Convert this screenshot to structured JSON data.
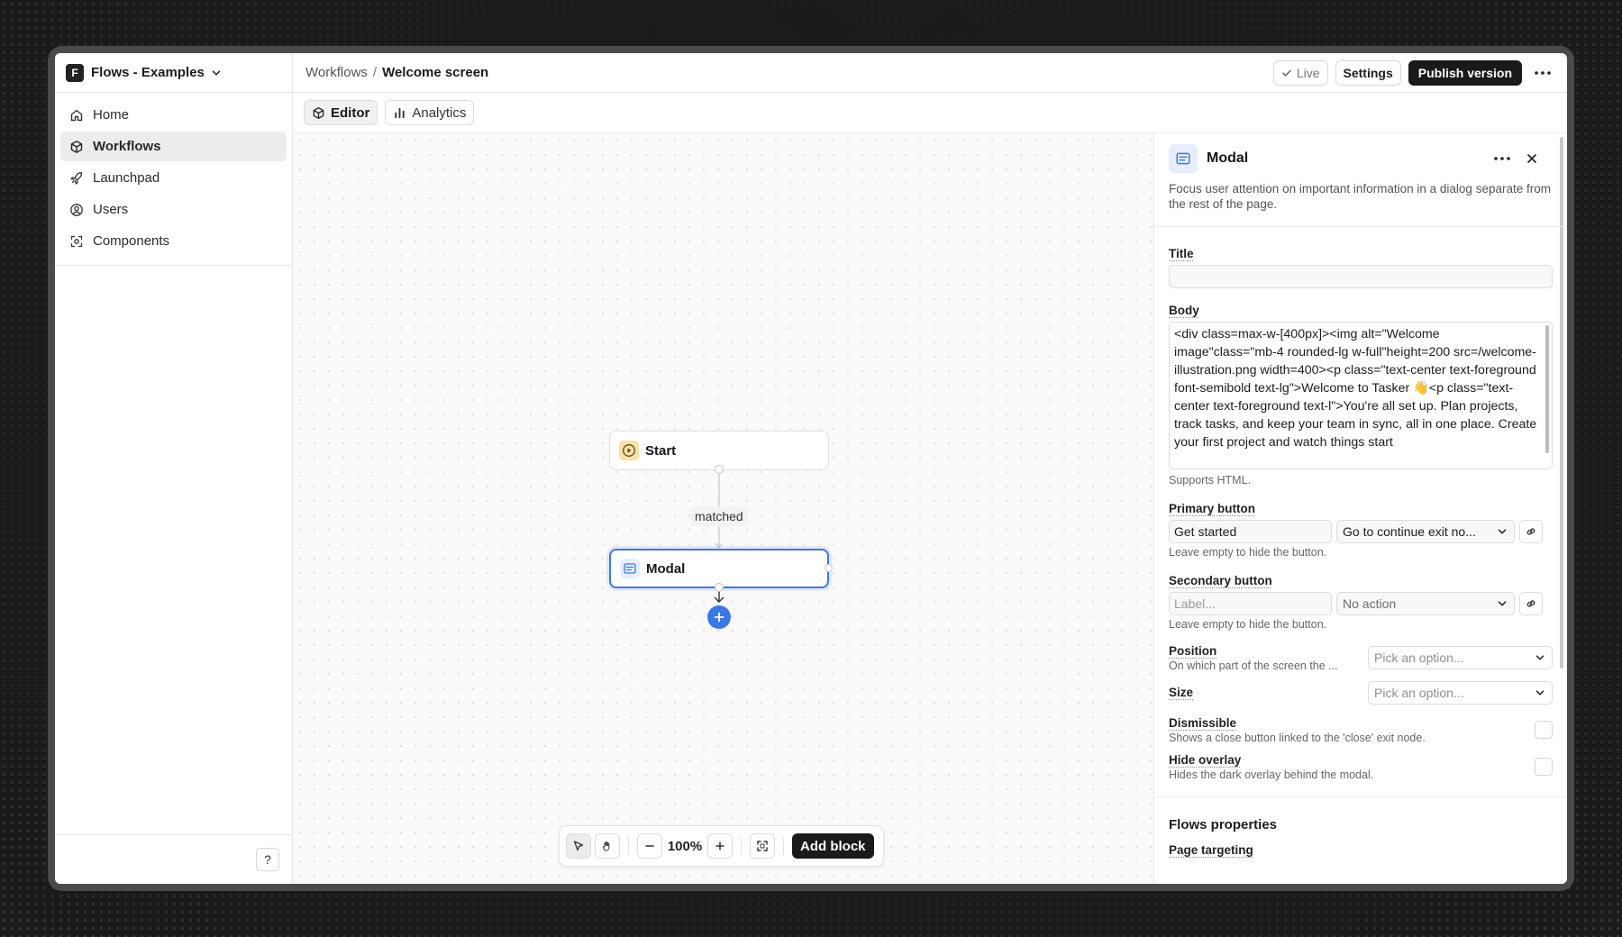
{
  "workspace": {
    "logo": "F",
    "name": "Flows - Examples"
  },
  "nav": [
    {
      "label": "Home",
      "icon": "home-icon",
      "active": false
    },
    {
      "label": "Workflows",
      "icon": "workflow-icon",
      "active": true
    },
    {
      "label": "Launchpad",
      "icon": "rocket-icon",
      "active": false
    },
    {
      "label": "Users",
      "icon": "user-circle-icon",
      "active": false
    },
    {
      "label": "Components",
      "icon": "components-icon",
      "active": false
    }
  ],
  "help_label": "?",
  "breadcrumb": {
    "parent": "Workflows",
    "separator": "/",
    "current": "Welcome screen"
  },
  "top_actions": {
    "live": "Live",
    "settings": "Settings",
    "publish": "Publish version"
  },
  "tabs": [
    {
      "label": "Editor",
      "active": true
    },
    {
      "label": "Analytics",
      "active": false
    }
  ],
  "canvas": {
    "nodes": [
      {
        "label": "Start",
        "icon": "play-icon"
      },
      {
        "label": "Modal",
        "icon": "modal-icon",
        "selected": true
      }
    ],
    "edge_label": "matched",
    "zoom": "100%",
    "add_block": "Add block"
  },
  "panel": {
    "title": "Modal",
    "description": "Focus user attention on important information in a dialog separate from the rest of the page.",
    "title_field": {
      "label": "Title",
      "value": ""
    },
    "body_field": {
      "label": "Body",
      "value": "<div class=max-w-[400px]><img alt=\"Welcome image\"class=\"mb-4 rounded-lg w-full\"height=200 src=/welcome-illustration.png width=400><p class=\"text-center text-foreground font-semibold text-lg\">Welcome to Tasker 👋<p class=\"text-center text-foreground text-l\">You're all set up. Plan projects, track tasks, and keep your team in sync, all in one place. Create your first project and watch things start",
      "help": "Supports HTML."
    },
    "primary_button": {
      "label": "Primary button",
      "value": "Get started",
      "action": "Go to continue exit no...",
      "help": "Leave empty to hide the button."
    },
    "secondary_button": {
      "label": "Secondary button",
      "placeholder": "Label...",
      "action": "No action",
      "help": "Leave empty to hide the button."
    },
    "position": {
      "label": "Position",
      "help": "On which part of the screen the ...",
      "placeholder": "Pick an option..."
    },
    "size": {
      "label": "Size",
      "placeholder": "Pick an option..."
    },
    "dismissible": {
      "label": "Dismissible",
      "help": "Shows a close button linked to the 'close' exit node.",
      "checked": false
    },
    "hide_overlay": {
      "label": "Hide overlay",
      "help": "Hides the dark overlay behind the modal.",
      "checked": false
    },
    "flows_properties": {
      "title": "Flows properties",
      "page_targeting": "Page targeting"
    }
  },
  "colors": {
    "accent": "#3b78e7",
    "dark": "#1a1a1a",
    "start_icon_bg": "#f8e2a8",
    "modal_icon_bg": "#e6eeff"
  }
}
